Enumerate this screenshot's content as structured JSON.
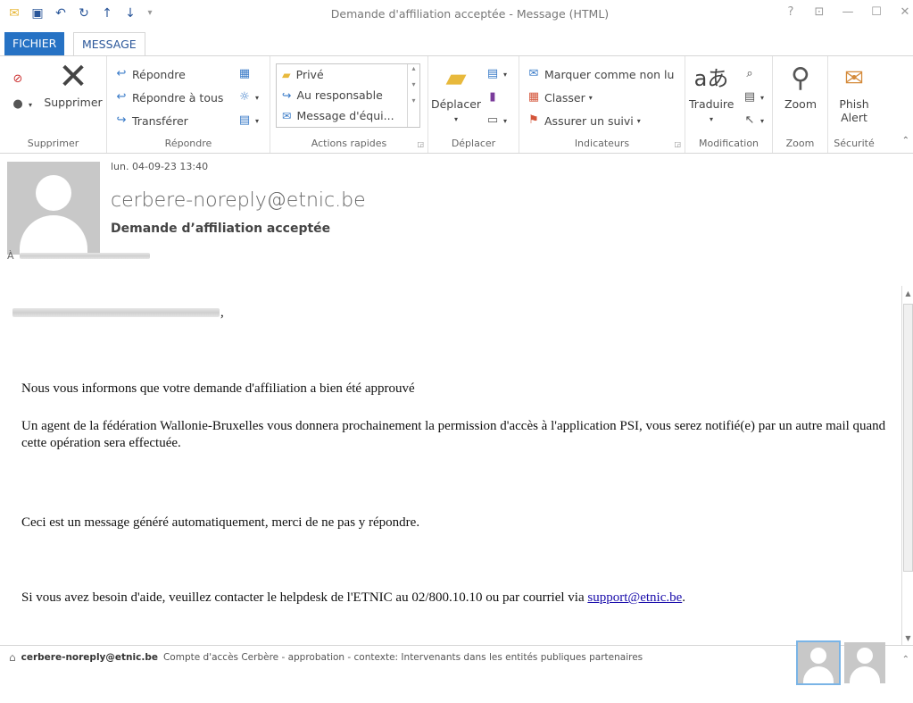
{
  "window": {
    "title": "Demande d'affiliation acceptée - Message (HTML)",
    "controls": [
      "?",
      "⊡",
      "—",
      "☐",
      "✕"
    ]
  },
  "tabs": [
    {
      "label": "FICHIER"
    },
    {
      "label": "MESSAGE"
    }
  ],
  "ribbon": {
    "supprimer": {
      "group_label": "Supprimer",
      "delete_label": "Supprimer"
    },
    "repondre": {
      "group_label": "Répondre",
      "reply": "Répondre",
      "reply_all": "Répondre à tous",
      "forward": "Transférer"
    },
    "actions_rapides": {
      "group_label": "Actions rapides",
      "items": [
        "Privé",
        "Au responsable",
        "Message d'équi..."
      ]
    },
    "deplacer": {
      "group_label": "Déplacer",
      "move_label": "Déplacer"
    },
    "indicateurs": {
      "group_label": "Indicateurs",
      "mark_unread": "Marquer comme non lu",
      "categorize": "Classer",
      "follow_up": "Assurer un suivi"
    },
    "modification": {
      "group_label": "Modification",
      "translate": "Traduire"
    },
    "zoom": {
      "group_label": "Zoom",
      "zoom_label": "Zoom"
    },
    "securite": {
      "group_label": "Sécurité",
      "phish_line1": "Phish",
      "phish_line2": "Alert"
    }
  },
  "message": {
    "datetime": "lun. 04-09-23 13:40",
    "sender": "cerbere-noreply@etnic.be",
    "subject": "Demande d’affiliation acceptée",
    "to_label": "À"
  },
  "body": {
    "greeting_suffix": ",",
    "p1": "Nous vous informons que votre demande d'affiliation a bien été approuvé",
    "p2": "Un agent de la fédération Wallonie-Bruxelles vous donnera prochainement la permission d'accès à l'application PSI, vous serez notifié(e) par un autre mail quand cette opération sera effectuée.",
    "p3": "Ceci est un message généré automatiquement, merci de ne pas y répondre.",
    "p4_text": "Si vous avez besoin d'aide, veuillez contacter le helpdesk de l'ETNIC au 02/800.10.10 ou par courriel via ",
    "p4_link": "support@etnic.be",
    "p4_end": "."
  },
  "footer": {
    "sender": "cerbere-noreply@etnic.be",
    "info": "Compte d'accès Cerbère - approbation - contexte: Intervenants dans les entités publiques partenaires"
  }
}
